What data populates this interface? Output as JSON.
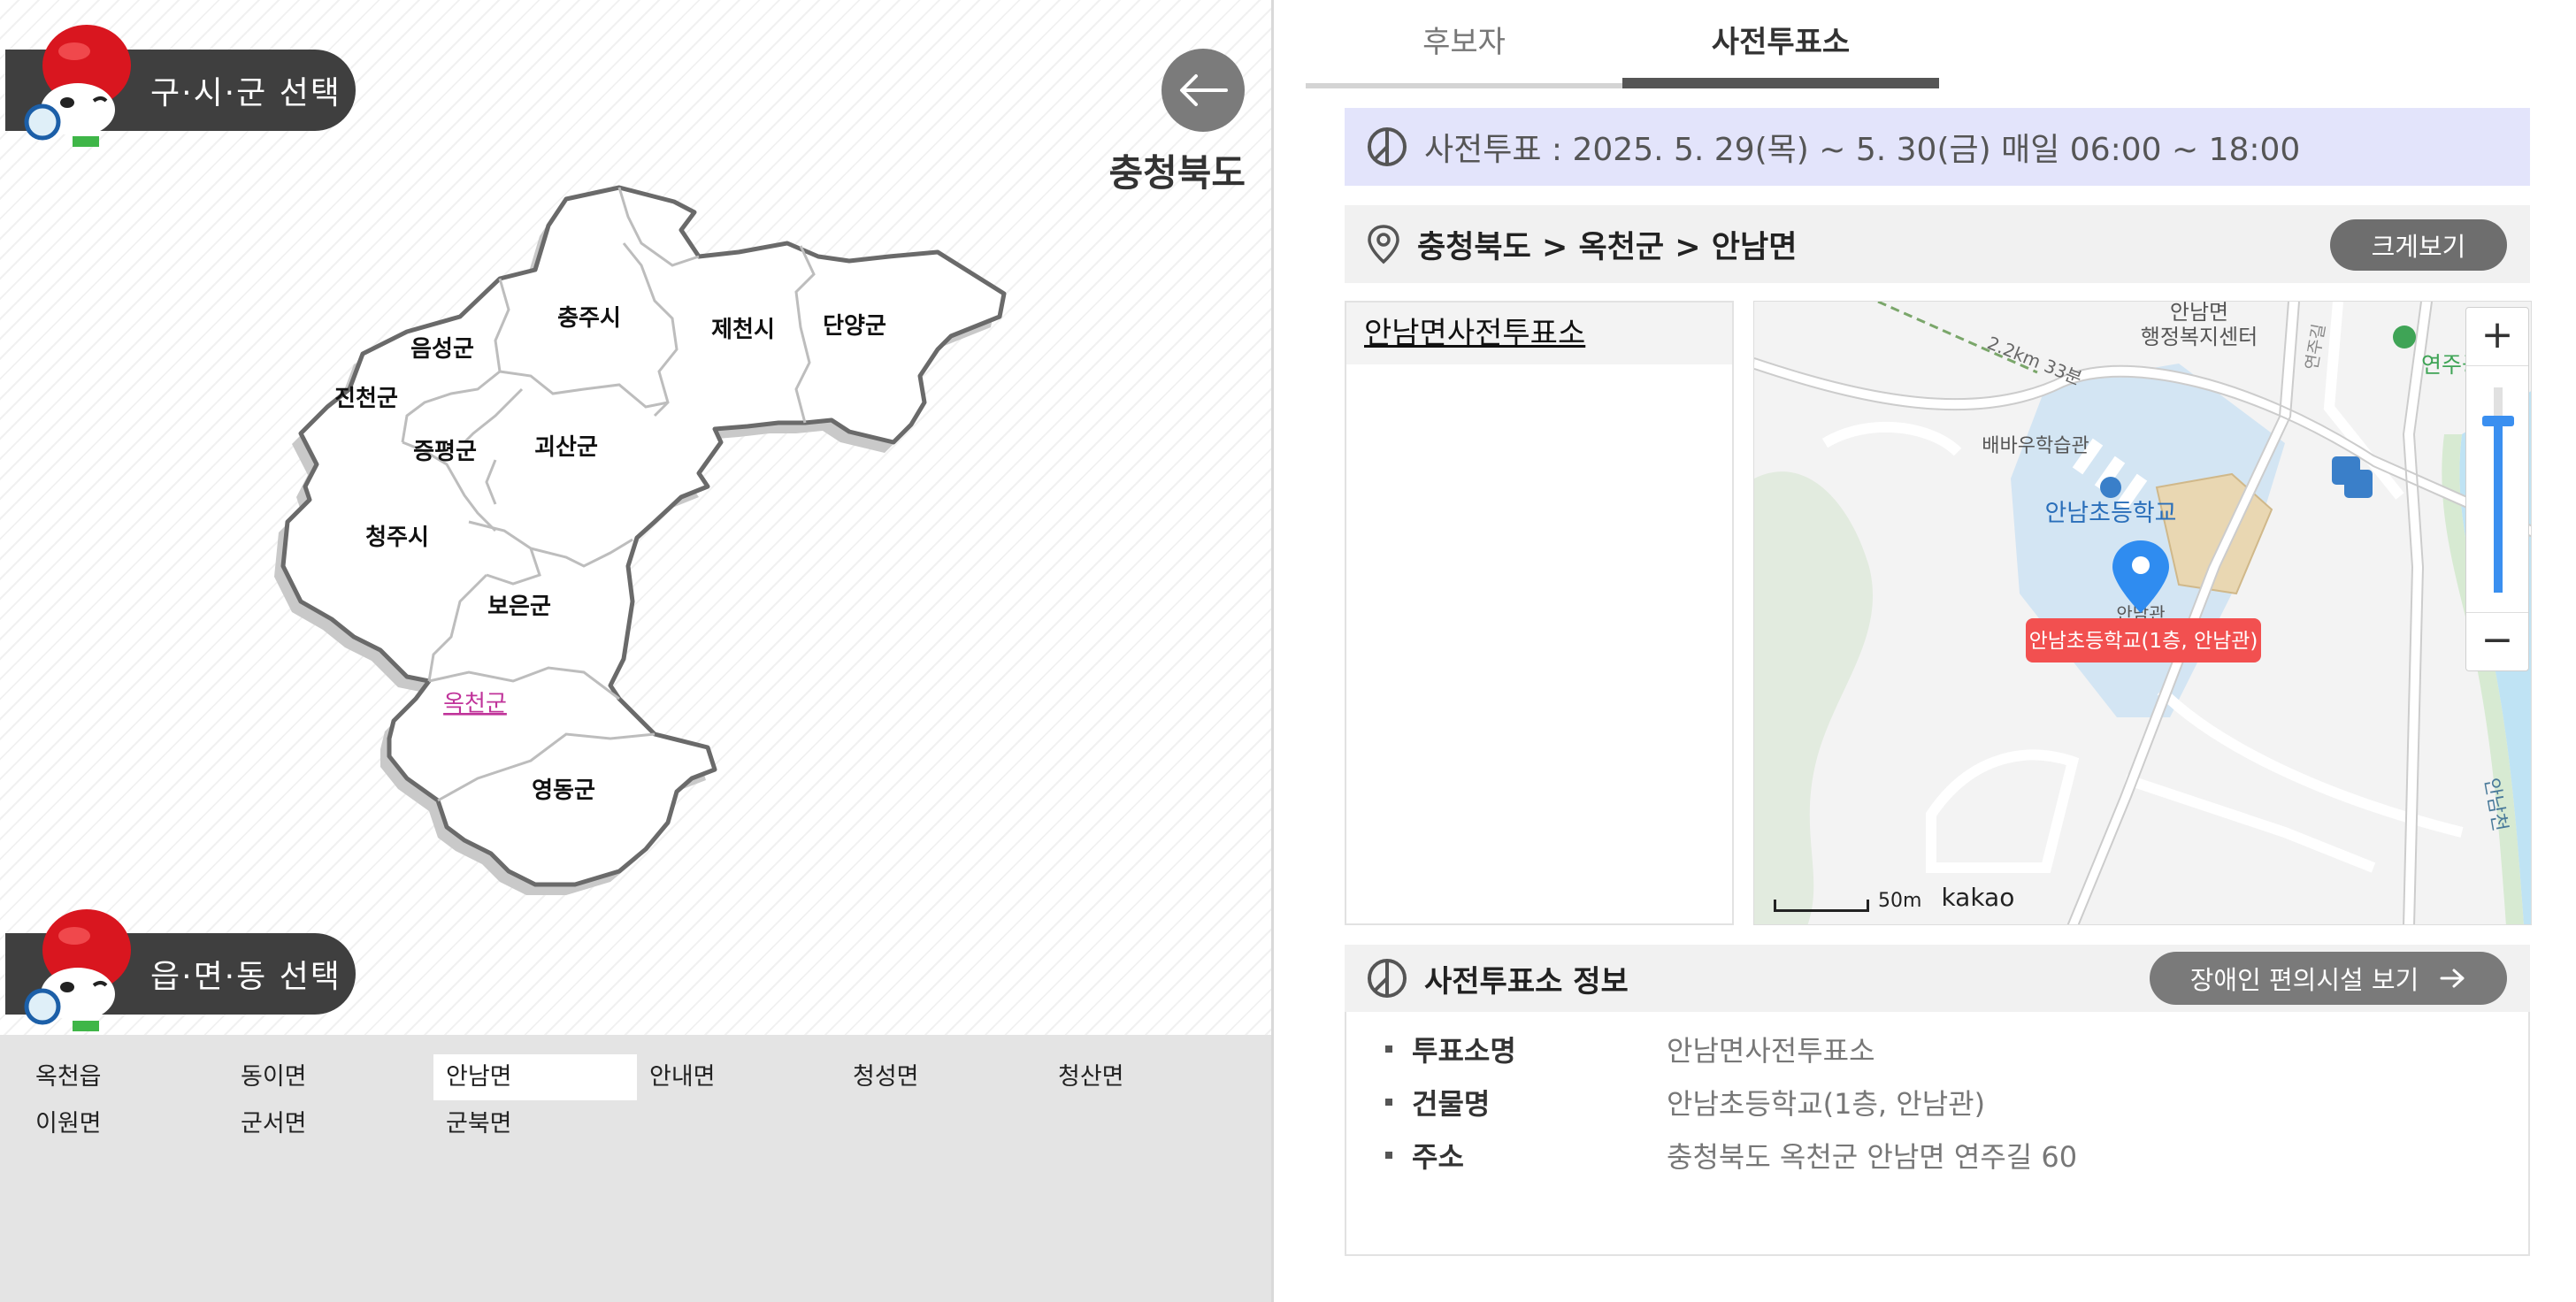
{
  "left": {
    "section1_label": "구·시·군 선택",
    "section2_label": "읍·면·동 선택",
    "region_title": "충청북도",
    "regions": [
      {
        "name": "음성군"
      },
      {
        "name": "충주시"
      },
      {
        "name": "제천시"
      },
      {
        "name": "단양군"
      },
      {
        "name": "진천군"
      },
      {
        "name": "증평군"
      },
      {
        "name": "괴산군"
      },
      {
        "name": "청주시"
      },
      {
        "name": "보은군"
      },
      {
        "name": "옥천군",
        "selected": true
      },
      {
        "name": "영동군"
      }
    ],
    "sub_districts": [
      "옥천읍",
      "동이면",
      "안남면",
      "안내면",
      "청성면",
      "청산면",
      "이원면",
      "군서면",
      "군북면"
    ],
    "selected_sub": "안남면"
  },
  "right": {
    "tabs": [
      {
        "label": "후보자"
      },
      {
        "label": "사전투표소",
        "active": true
      }
    ],
    "period": "사전투표 : 2025. 5. 29(목) ~ 5. 30(금) 매일 06:00 ~ 18:00",
    "location": "충청북도 > 옥천군 > 안남면",
    "zoom_view_label": "크게보기",
    "station_name": "안남면사전투표소",
    "map": {
      "labels": {
        "office": "안남면",
        "office2": "행정복지센터",
        "park": "연주공원",
        "school": "안남초등학교",
        "learn": "배바우학습관",
        "hall": "안남관",
        "marker": "안남초등학교(1층, 안남관)",
        "route": "2.2km 33분",
        "road": "연주길",
        "river": "안남천"
      },
      "zoom_in": "+",
      "zoom_out": "−",
      "scale": "50m",
      "brand": "kakao"
    },
    "info_title": "사전투표소 정보",
    "access_label": "장애인 편의시설 보기",
    "info": [
      {
        "key": "투표소명",
        "value": "안남면사전투표소"
      },
      {
        "key": "건물명",
        "value": "안남초등학교(1층, 안남관)"
      },
      {
        "key": "주소",
        "value": "충청북도 옥천군 안남면 연주길 60"
      }
    ]
  },
  "colors": {
    "selected_region": "#c0339a",
    "marker": "#f25050",
    "period_bg": "#e3e4fb",
    "pill": "#3f3f3f"
  }
}
